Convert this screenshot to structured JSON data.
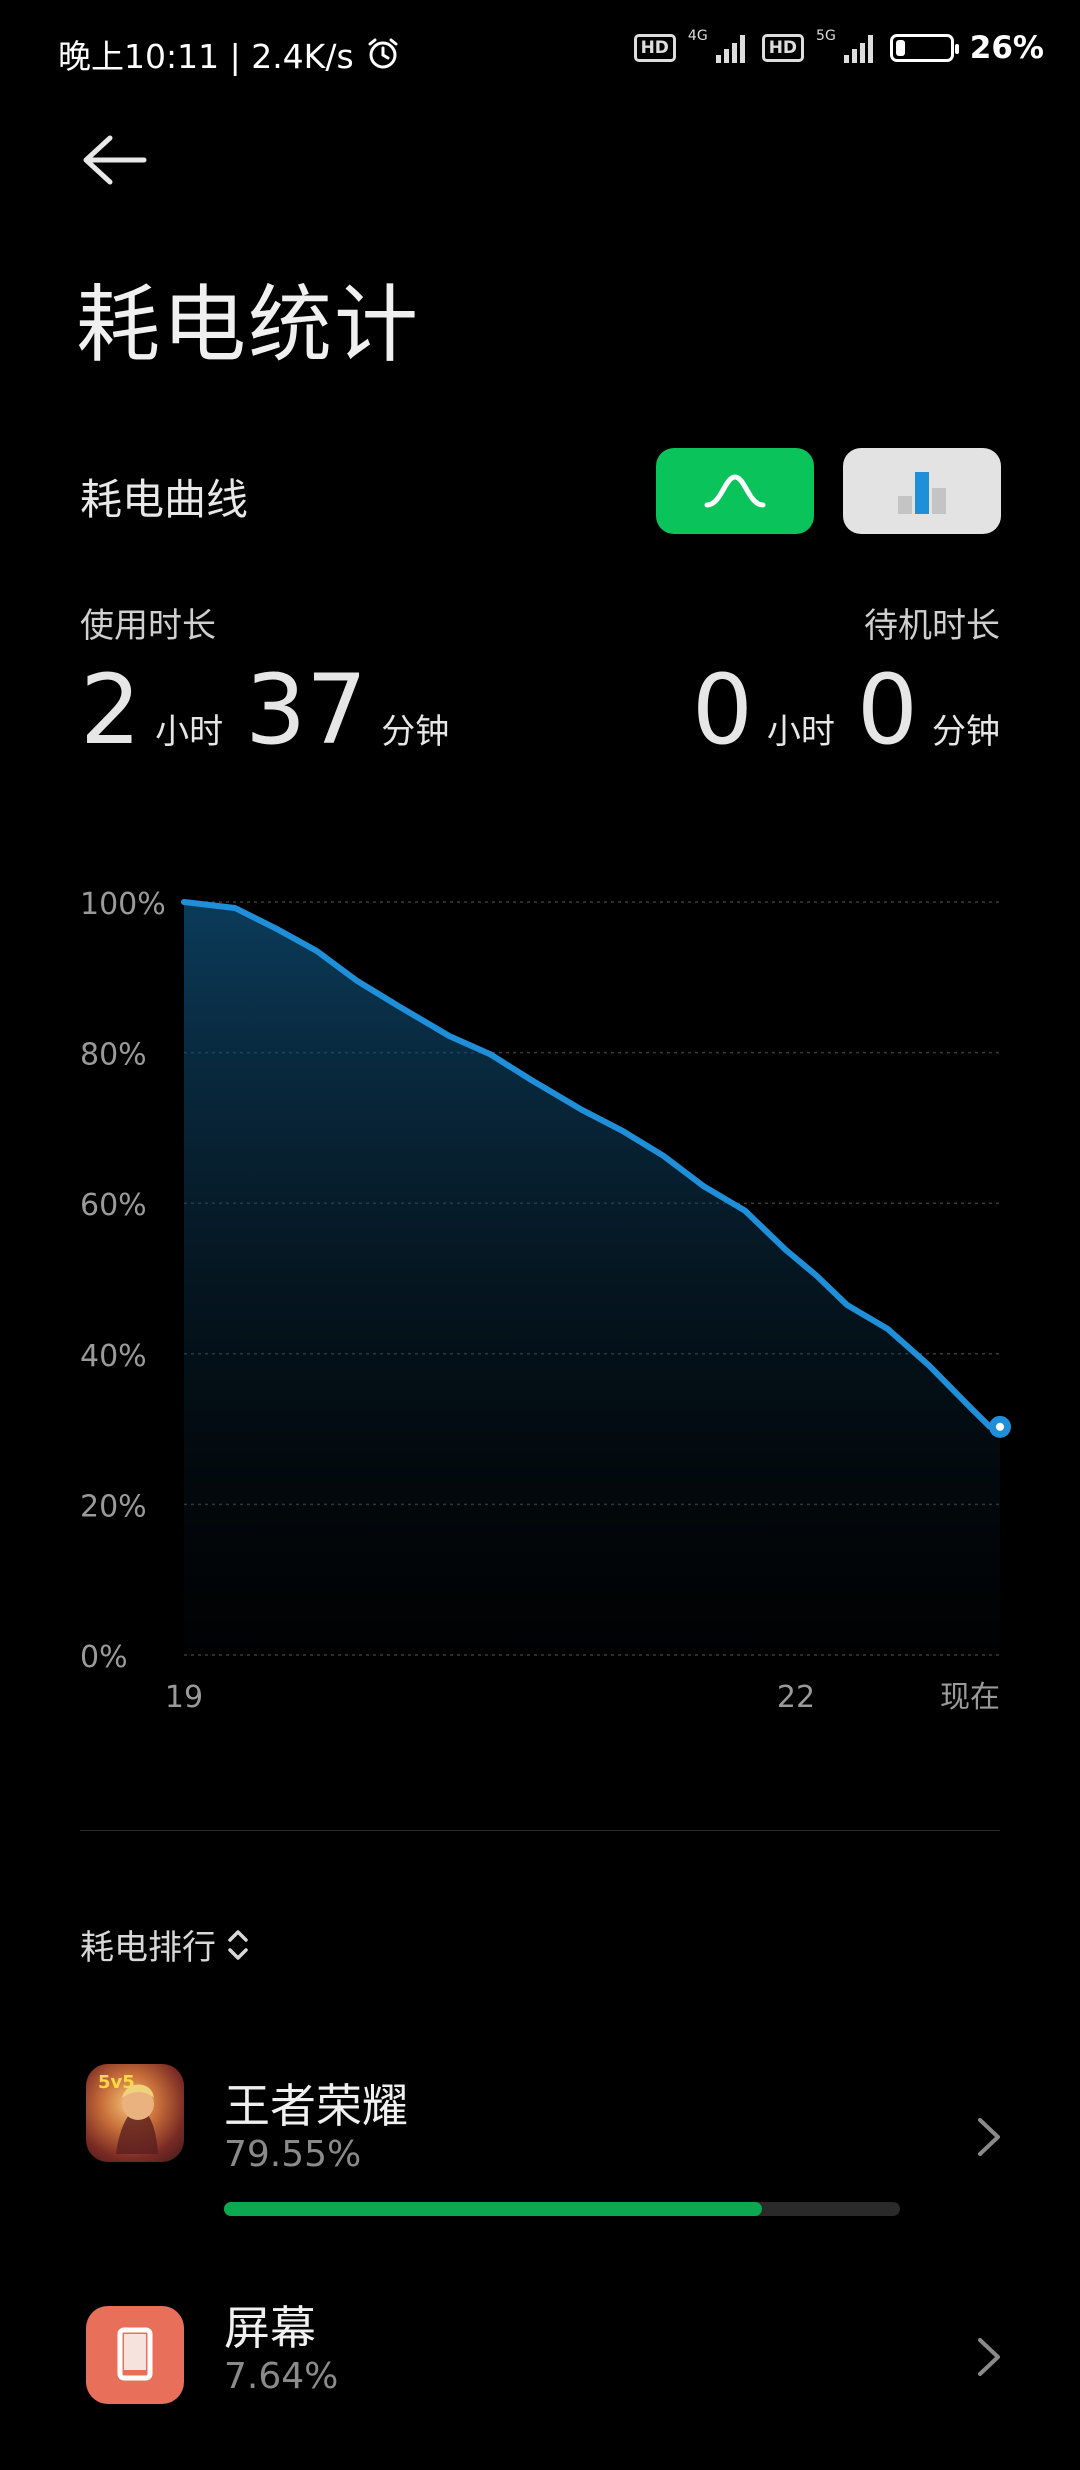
{
  "status_bar": {
    "time_speed": "晚上10:11 | 2.4K/s",
    "hd1": "HD",
    "net1": "4G",
    "hd2": "HD",
    "net2": "5G",
    "battery_percent": "26%",
    "battery_level": 0.26,
    "icons": [
      "alarm-icon",
      "signal-icon",
      "battery-icon"
    ]
  },
  "page": {
    "title": "耗电统计",
    "back_icon": "arrow-left-icon"
  },
  "curve_section": {
    "label": "耗电曲线",
    "toggle_curve_icon": "curve-icon",
    "toggle_bars_icon": "bar-chart-icon",
    "active_toggle": "curve",
    "accent_color": "#0ac35a"
  },
  "usage": {
    "label": "使用时长",
    "hours": "2",
    "hours_unit": "小时",
    "minutes": "37",
    "minutes_unit": "分钟"
  },
  "standby": {
    "label": "待机时长",
    "hours": "0",
    "hours_unit": "小时",
    "minutes": "0",
    "minutes_unit": "分钟"
  },
  "chart_data": {
    "type": "area",
    "title": "",
    "xlabel": "",
    "ylabel": "",
    "x_tick_labels": [
      "19",
      "22",
      "现在"
    ],
    "x_tick_values": [
      19,
      22,
      23.0
    ],
    "y_tick_labels": [
      "100%",
      "80%",
      "60%",
      "40%",
      "20%",
      "0%"
    ],
    "y_tick_values": [
      100,
      80,
      60,
      40,
      20,
      0
    ],
    "ylim": [
      0,
      100
    ],
    "xlim": [
      19,
      23.0
    ],
    "grid": true,
    "line_color": "#1e8fd8",
    "series": [
      {
        "x": [
          19.0,
          19.25,
          19.45,
          19.65,
          19.85,
          20.05,
          20.3,
          20.5,
          20.7,
          20.95,
          21.15,
          21.35,
          21.55,
          21.75,
          21.95,
          22.1,
          22.25,
          22.45,
          22.65,
          22.85,
          22.95,
          23.0
        ],
        "values": [
          100,
          99.2,
          96.5,
          93.5,
          89.5,
          86.2,
          82.2,
          79.8,
          76.4,
          72.4,
          69.6,
          66.3,
          62.2,
          59.0,
          53.8,
          50.4,
          46.5,
          43.3,
          38.5,
          33.0,
          30.3,
          30.3
        ]
      }
    ]
  },
  "ranking": {
    "label": "耗电排行",
    "sort_icon": "sort-updown-icon",
    "items": [
      {
        "name": "王者荣耀",
        "percent": "79.55%",
        "fraction": 0.7955,
        "icon": "game-app-icon"
      },
      {
        "name": "屏幕",
        "percent": "7.64%",
        "fraction": 0.0764,
        "icon": "screen-icon",
        "icon_color": "#e8705a"
      }
    ],
    "chevron_icon": "chevron-right-icon"
  }
}
